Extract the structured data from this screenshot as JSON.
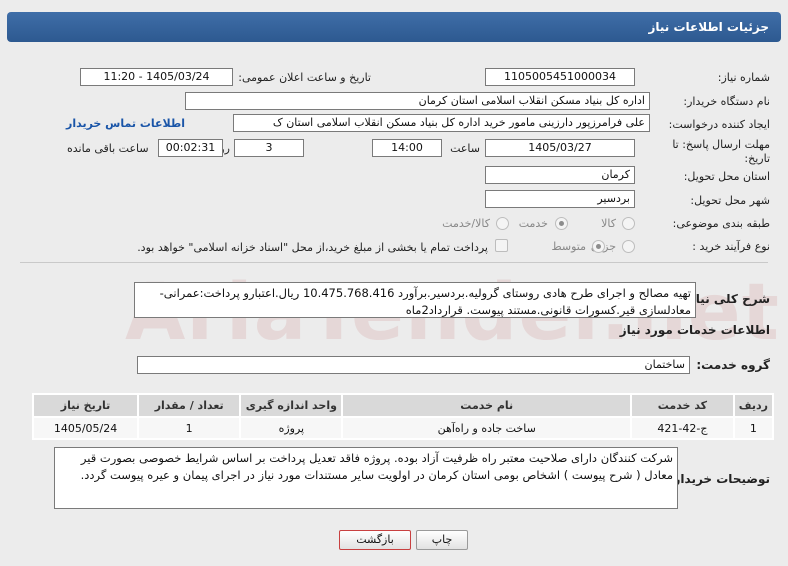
{
  "header": {
    "title": "جزئیات اطلاعات نیاز"
  },
  "fields": {
    "need_number_label": "شماره نیاز:",
    "need_number": "1105005451000034",
    "announce_label": "تاریخ و ساعت اعلان عمومی:",
    "announce_value": "1405/03/24 - 11:20",
    "buyer_org_label": "نام دستگاه خریدار:",
    "buyer_org": "اداره کل بنیاد مسکن انقلاب اسلامی استان کرمان",
    "creator_label": "ایجاد کننده درخواست:",
    "creator": "علی فرامرزپور دارزینی مامور خرید اداره کل بنیاد مسکن انقلاب اسلامی استان ک",
    "contact_link": "اطلاعات تماس خریدار",
    "deadline_label": "مهلت ارسال پاسخ: تا تاریخ:",
    "deadline_date": "1405/03/27",
    "time_label": "ساعت",
    "deadline_time": "14:00",
    "days_value": "3",
    "days_label": "روز و",
    "remaining_time": "00:02:31",
    "remaining_label": "ساعت باقی مانده",
    "province_label": "استان محل تحویل:",
    "province": "کرمان",
    "city_label": "شهر محل تحویل:",
    "city": "بردسیر",
    "category_label": "طبقه بندی موضوعی:",
    "category_options": [
      "کالا",
      "خدمت",
      "کالا/خدمت"
    ],
    "category_selected": "خدمت",
    "process_label": "نوع فرآیند خرید :",
    "process_options": [
      "جزیی",
      "متوسط"
    ],
    "process_selected": "متوسط",
    "treasury_note": "پرداخت تمام یا بخشی از مبلغ خرید،از محل \"اسناد خزانه اسلامی\" خواهد بود."
  },
  "description": {
    "label": "شرح کلی نیاز:",
    "text": "تهیه مصالح و اجرای طرح هادی روستای گرولیه.بردسیر.برآورد 10.475.768.416 ریال.اعتبارو پرداخت:عمرانی-معادلسازی قیر.کسورات قانونی.مستند پیوست. قرارداد2ماه"
  },
  "services": {
    "section_title": "اطلاعات خدمات مورد نیاز",
    "group_label": "گروه خدمت:",
    "group_value": "ساختمان",
    "columns": [
      "ردیف",
      "کد خدمت",
      "نام خدمت",
      "واحد اندازه گیری",
      "تعداد / مقدار",
      "تاریخ نیاز"
    ],
    "rows": [
      [
        "1",
        "ج-42-421",
        "ساخت جاده و راه‌آهن",
        "پروژه",
        "1",
        "1405/05/24"
      ]
    ]
  },
  "buyer_notes": {
    "label": "توضیحات خریدار:",
    "text": "شرکت کنندگان دارای صلاحیت معتبر راه ظرفیت آزاد بوده. پروژه فاقد تعدیل پرداخت بر اساس شرایط خصوصی بصورت قیر معادل ( شرح پیوست ) اشخاص بومی استان کرمان در اولویت سایر مستندات مورد نیاز در اجرای پیمان و عیره پیوست گردد."
  },
  "buttons": {
    "print": "چاپ",
    "back": "بازگشت"
  },
  "colors": {
    "header_bg": "#2d5990",
    "link": "#1a55a8",
    "back_border": "#c84040"
  }
}
